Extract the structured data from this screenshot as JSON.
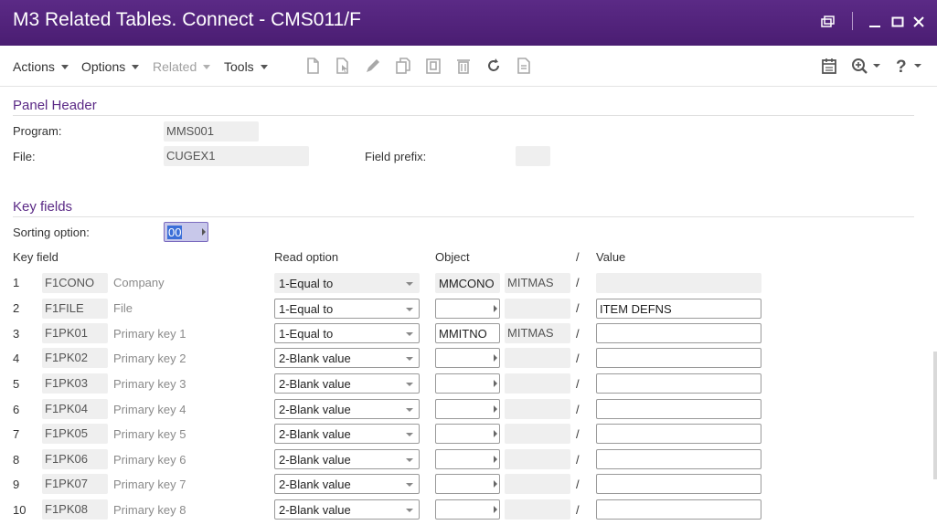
{
  "window": {
    "title": "M3 Related Tables. Connect - CMS011/F",
    "titlebar_color": "#4f2079"
  },
  "toolbar": {
    "menus": [
      "Actions",
      "Options",
      "Related",
      "Tools"
    ],
    "icons": [
      "new-icon",
      "copy-icon",
      "edit-icon",
      "duplicate-icon",
      "paste-icon",
      "delete-icon",
      "refresh-icon",
      "details-icon"
    ],
    "right_icons": [
      "calendar-icon",
      "zoom-in-icon",
      "help-icon"
    ]
  },
  "panel_header": {
    "title": "Panel Header",
    "program_label": "Program:",
    "program_value": "MMS001",
    "file_label": "File:",
    "file_value": "CUGEX1",
    "field_prefix_label": "Field prefix:",
    "field_prefix_value": ""
  },
  "key_fields": {
    "title": "Key fields",
    "sorting_label": "Sorting option:",
    "sorting_value": "00",
    "headers": {
      "key_field": "Key field",
      "read_option": "Read option",
      "object": "Object",
      "slash": "/",
      "value": "Value"
    },
    "rows": [
      {
        "num": "1",
        "field": "F1CONO",
        "desc": "Company",
        "read": "1-Equal to",
        "object": "MMCONO",
        "object2": "MITMAS",
        "slash": "/",
        "value": "",
        "editable": false
      },
      {
        "num": "2",
        "field": "F1FILE",
        "desc": "File",
        "read": "1-Equal to",
        "object": "",
        "object2": "",
        "slash": "/",
        "value": "ITEM DEFNS",
        "editable": true
      },
      {
        "num": "3",
        "field": "F1PK01",
        "desc": "Primary key 1",
        "read": "1-Equal to",
        "object": "MMITNO",
        "object2": "MITMAS",
        "slash": "/",
        "value": "",
        "editable": true
      },
      {
        "num": "4",
        "field": "F1PK02",
        "desc": "Primary key 2",
        "read": "2-Blank value",
        "object": "",
        "object2": "",
        "slash": "/",
        "value": "",
        "editable": true
      },
      {
        "num": "5",
        "field": "F1PK03",
        "desc": "Primary key 3",
        "read": "2-Blank value",
        "object": "",
        "object2": "",
        "slash": "/",
        "value": "",
        "editable": true
      },
      {
        "num": "6",
        "field": "F1PK04",
        "desc": "Primary key 4",
        "read": "2-Blank value",
        "object": "",
        "object2": "",
        "slash": "/",
        "value": "",
        "editable": true
      },
      {
        "num": "7",
        "field": "F1PK05",
        "desc": "Primary key 5",
        "read": "2-Blank value",
        "object": "",
        "object2": "",
        "slash": "/",
        "value": "",
        "editable": true
      },
      {
        "num": "8",
        "field": "F1PK06",
        "desc": "Primary key 6",
        "read": "2-Blank value",
        "object": "",
        "object2": "",
        "slash": "/",
        "value": "",
        "editable": true
      },
      {
        "num": "9",
        "field": "F1PK07",
        "desc": "Primary key 7",
        "read": "2-Blank value",
        "object": "",
        "object2": "",
        "slash": "/",
        "value": "",
        "editable": true
      },
      {
        "num": "10",
        "field": "F1PK08",
        "desc": "Primary key 8",
        "read": "2-Blank value",
        "object": "",
        "object2": "",
        "slash": "/",
        "value": "",
        "editable": true
      }
    ]
  }
}
